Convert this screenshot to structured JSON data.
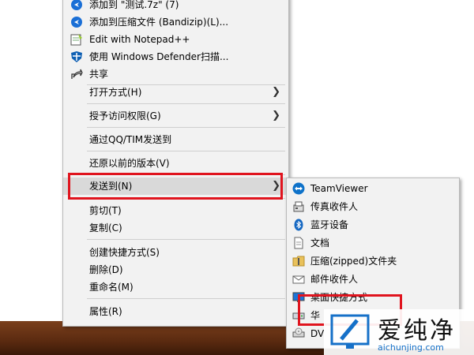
{
  "context_menu": {
    "items": [
      {
        "label": "添加到 \"测试.7z\" (7)",
        "icon": "bandizip-icon"
      },
      {
        "label": "添加到压缩文件 (Bandizip)(L)...",
        "icon": "bandizip-icon"
      },
      {
        "label": "Edit with Notepad++",
        "icon": "notepad-plus-plus-icon"
      },
      {
        "label": "使用 Windows Defender扫描...",
        "icon": "windows-defender-icon"
      },
      {
        "label": "共享",
        "icon": "share-icon"
      },
      {
        "label": "打开方式(H)",
        "has_submenu": true
      },
      {
        "label": "授予访问权限(G)",
        "has_submenu": true
      },
      {
        "label": "通过QQ/TIM发送到"
      },
      {
        "label": "还原以前的版本(V)"
      },
      {
        "label": "发送到(N)",
        "has_submenu": true,
        "highlighted": true
      },
      {
        "label": "剪切(T)"
      },
      {
        "label": "复制(C)"
      },
      {
        "label": "创建快捷方式(S)"
      },
      {
        "label": "删除(D)"
      },
      {
        "label": "重命名(M)"
      },
      {
        "label": "属性(R)"
      }
    ]
  },
  "send_to_menu": {
    "items": [
      {
        "label": "TeamViewer",
        "icon": "teamviewer-icon"
      },
      {
        "label": "传真收件人",
        "icon": "fax-icon"
      },
      {
        "label": "蓝牙设备",
        "icon": "bluetooth-icon"
      },
      {
        "label": "文档",
        "icon": "documents-icon"
      },
      {
        "label": "压缩(zipped)文件夹",
        "icon": "zip-folder-icon"
      },
      {
        "label": "邮件收件人",
        "icon": "mail-icon"
      },
      {
        "label": "桌面快捷方式",
        "icon": "desktop-icon"
      },
      {
        "label": "华",
        "icon": "drive-icon"
      },
      {
        "label": "DV",
        "icon": "dvd-drive-icon"
      }
    ]
  },
  "watermark": {
    "title": "爱纯净",
    "url": "aichunjing.com"
  },
  "colors": {
    "highlight_box": "#e0141e",
    "menu_bg": "#f2f2f2",
    "accent_blue": "#1570c8"
  }
}
